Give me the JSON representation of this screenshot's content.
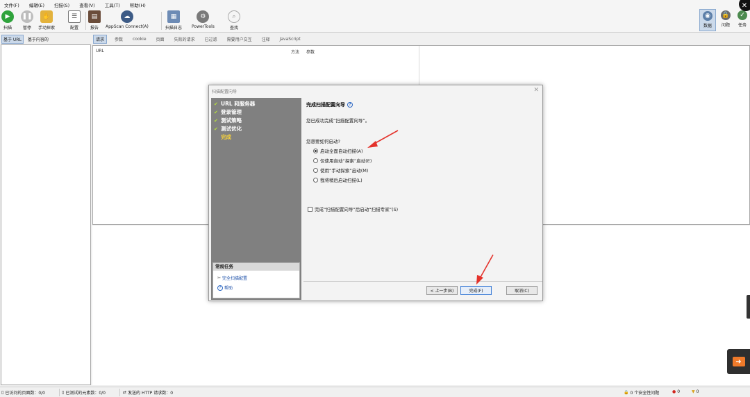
{
  "menu": [
    "文件(F)",
    "编辑(E)",
    "扫描(S)",
    "查看(V)",
    "工具(T)",
    "帮助(H)"
  ],
  "toolbar": {
    "scan": "扫描",
    "pause": "暂停",
    "manual_explore": "手动探索",
    "config": "配置",
    "report": "报告",
    "appscan_connect": "AppScan Connect(A)",
    "scan_log": "扫描日志",
    "powertools": "PowerTools",
    "find": "查找",
    "data": "数据",
    "issues": "问题",
    "tasks": "任务"
  },
  "left_tabs": [
    "基于 URL",
    "基于内容的"
  ],
  "main_tabs": [
    "请求",
    "参数",
    "cookie",
    "页面",
    "失败的请求",
    "已过滤",
    "需要用户交互",
    "注释",
    "JavaScript"
  ],
  "table_headers": {
    "url": "URL",
    "method": "方法",
    "params": "参数"
  },
  "dialog": {
    "title": "扫描配置向导",
    "steps": [
      {
        "label": "URL 和服务器",
        "done": true
      },
      {
        "label": "登录管理",
        "done": true
      },
      {
        "label": "测试策略",
        "done": true
      },
      {
        "label": "测试优化",
        "done": true
      },
      {
        "label": "完成",
        "done": false
      }
    ],
    "common_tasks_title": "常规任务",
    "common_tasks": [
      "完全扫描配置",
      "帮助"
    ],
    "content_title": "完成扫描配置向导",
    "intro": "您已成功完成“扫描配置向导”。",
    "question": "您想要如何启动?",
    "options": [
      {
        "label": "启动全面自动扫描(A)",
        "selected": true
      },
      {
        "label": "仅使用自动“探索”启动(E)",
        "selected": false
      },
      {
        "label": "使用“手动探索”启动(M)",
        "selected": false
      },
      {
        "label": "我将稍后启动扫描(L)",
        "selected": false
      }
    ],
    "checkbox_label": "完成“扫描配置向导”后启动“扫描专家”(S)",
    "buttons": {
      "back": "< 上一步(B)",
      "finish": "完成(F)",
      "cancel": "取消(C)"
    }
  },
  "status": {
    "visited_pages": "已访问的页面数：0/0",
    "tested_elements": "已测试的元素数：0/0",
    "http_requests": "发送的 HTTP 请求数：0",
    "security_issues": "0 个安全性问题",
    "high": "0",
    "medium": "0"
  },
  "colors": {
    "accent_red": "#e4322b",
    "step_done": "#b7e13a",
    "step_current": "#f6d23c",
    "sidebar": "#808080"
  }
}
